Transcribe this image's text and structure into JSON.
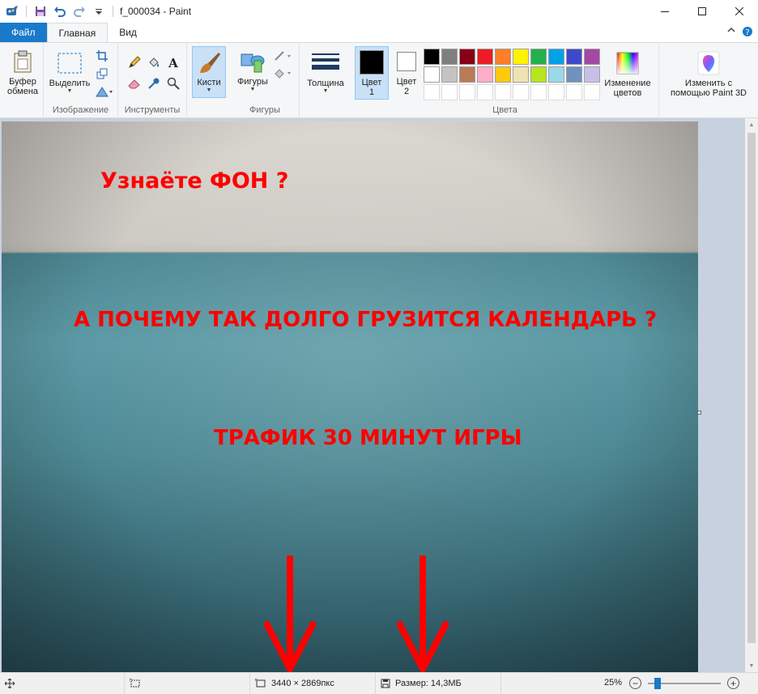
{
  "window": {
    "title": "f_000034 - Paint"
  },
  "tabs": {
    "file": "Файл",
    "home": "Главная",
    "view": "Вид"
  },
  "ribbon": {
    "clipboard": {
      "label_line1": "Буфер",
      "label_line2": "обмена"
    },
    "image": {
      "select": "Выделить",
      "group": "Изображение"
    },
    "tools": {
      "group": "Инструменты"
    },
    "brushes": {
      "label": "Кисти"
    },
    "shapes": {
      "label": "Фигуры",
      "group": "Фигуры"
    },
    "size": {
      "label": "Толщина"
    },
    "colors": {
      "color1": "Цвет",
      "color1_num": "1",
      "color2": "Цвет",
      "color2_num": "2",
      "group": "Цвета",
      "edit_line1": "Изменение",
      "edit_line2": "цветов",
      "color1_value": "#000000",
      "color2_value": "#ffffff",
      "palette_row1": [
        "#000000",
        "#7f7f7f",
        "#880015",
        "#ed1c24",
        "#ff7f27",
        "#fff200",
        "#22b14c",
        "#00a2e8",
        "#3f48cc",
        "#a349a4"
      ],
      "palette_row2": [
        "#ffffff",
        "#c3c3c3",
        "#b97a57",
        "#ffaec9",
        "#ffc90e",
        "#efe4b0",
        "#b5e61d",
        "#99d9ea",
        "#7092be",
        "#c8bfe7"
      ]
    },
    "paint3d": {
      "line1": "Изменить с",
      "line2": "помощью Paint 3D"
    }
  },
  "canvas": {
    "text1": "Узнаёте ФОН ?",
    "text2": "А ПОЧЕМУ ТАК ДОЛГО ГРУЗИТСЯ КАЛЕНДАРЬ ?",
    "text3": "ТРАФИК 30 МИНУТ ИГРЫ",
    "text_color": "#ff0000"
  },
  "status": {
    "dimensions": "3440 × 2869пкс",
    "size": "Размер: 14,3МБ",
    "zoom": "25%"
  }
}
